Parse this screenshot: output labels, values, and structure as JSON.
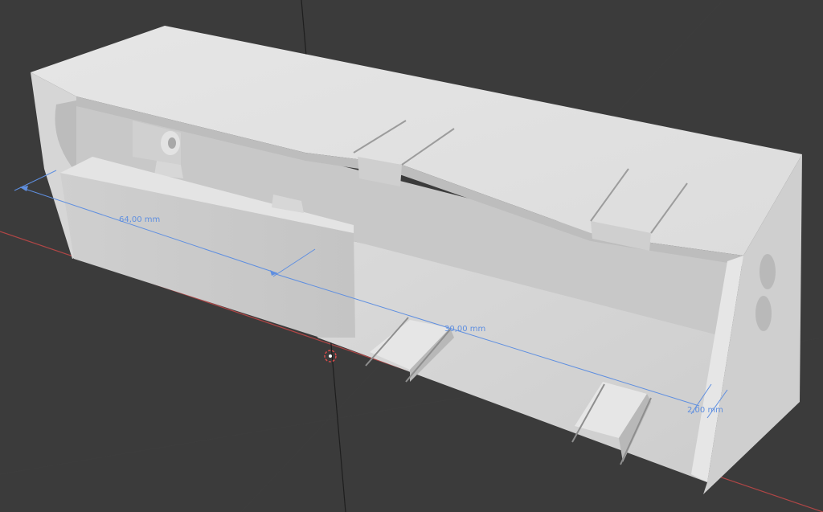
{
  "viewport": {
    "background_color": "#3b3b3b",
    "model_color": "#dcdcdc",
    "x_axis_color": "#b04646",
    "z_axis_color": "#1e1e1e",
    "measure_color": "#5f8fe0"
  },
  "measurements": [
    {
      "id": "length",
      "label": "64,00 mm"
    },
    {
      "id": "width",
      "label": "30,00 mm"
    },
    {
      "id": "wall",
      "label": "2,00 mm"
    }
  ],
  "objects": {
    "main": "Enclosure",
    "cursor": "3d-cursor"
  }
}
